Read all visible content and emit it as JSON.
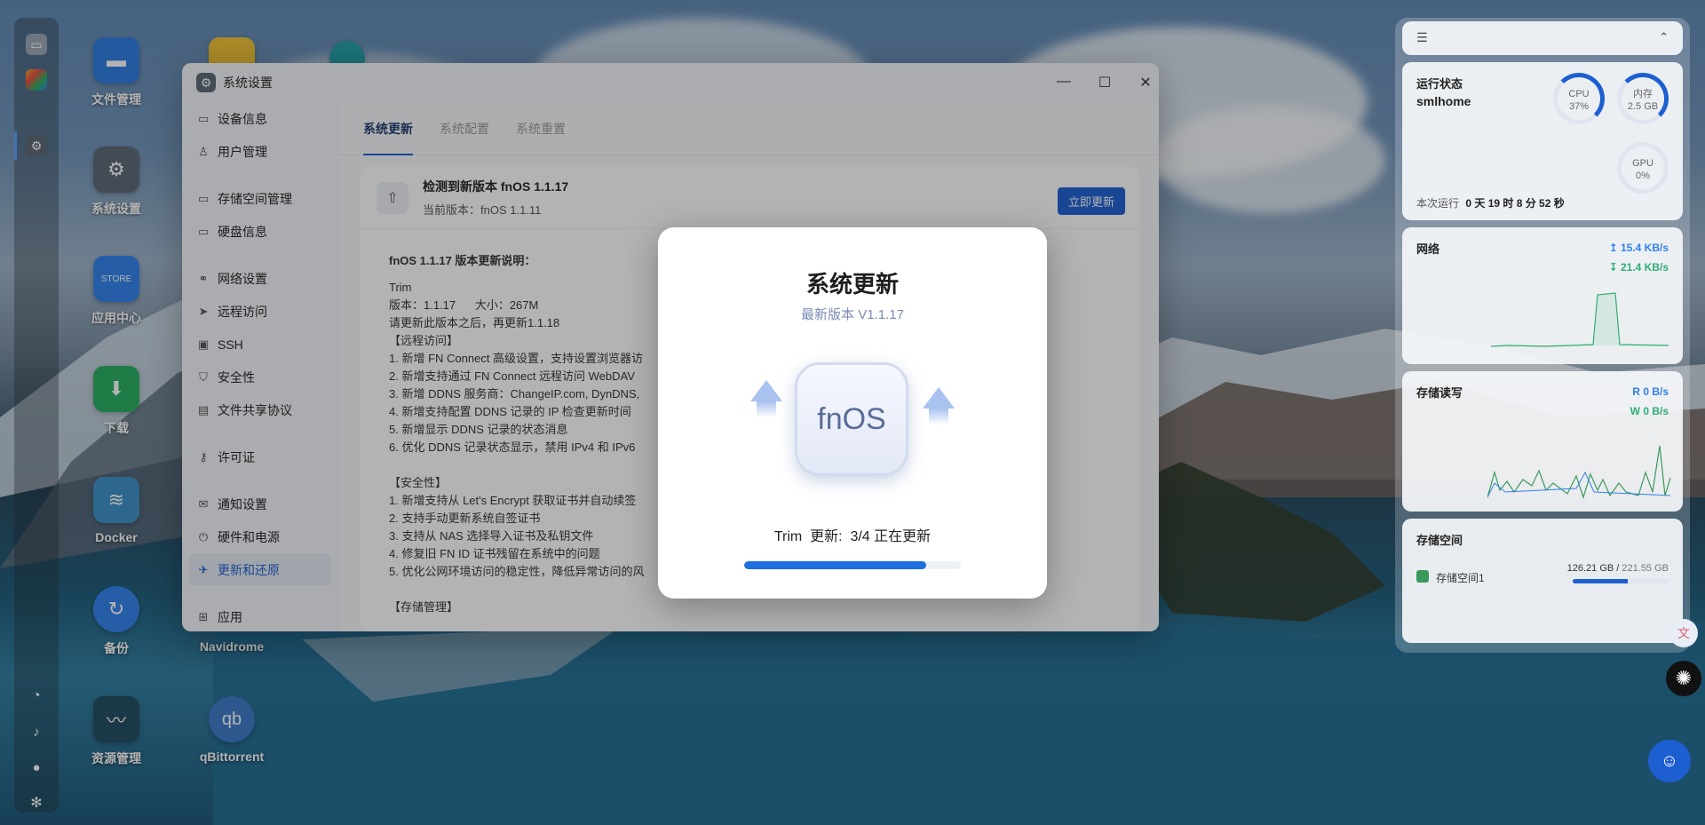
{
  "desktop": {
    "icons": [
      {
        "label": "文件管理"
      },
      {
        "label": "系统设置"
      },
      {
        "label": "应用中心"
      },
      {
        "label": "下载"
      },
      {
        "label": "Docker"
      },
      {
        "label": "备份"
      },
      {
        "label": "Navidrome"
      },
      {
        "label": "资源管理"
      },
      {
        "label": "qBittorrent"
      }
    ]
  },
  "window": {
    "title": "系统设置",
    "sidebar": [
      {
        "label": "设备信息",
        "icon": "device-icon"
      },
      {
        "label": "用户管理",
        "icon": "user-icon"
      },
      {
        "label": "存储空间管理",
        "icon": "storage-icon"
      },
      {
        "label": "硬盘信息",
        "icon": "disk-icon"
      },
      {
        "label": "网络设置",
        "icon": "network-icon"
      },
      {
        "label": "远程访问",
        "icon": "send-icon"
      },
      {
        "label": "SSH",
        "icon": "ssh-icon"
      },
      {
        "label": "安全性",
        "icon": "shield-icon"
      },
      {
        "label": "文件共享协议",
        "icon": "file-icon"
      },
      {
        "label": "许可证",
        "icon": "key-icon"
      },
      {
        "label": "通知设置",
        "icon": "mail-icon"
      },
      {
        "label": "硬件和电源",
        "icon": "power-icon"
      },
      {
        "label": "更新和还原",
        "icon": "rocket-icon"
      },
      {
        "label": "应用",
        "icon": "apps-icon"
      }
    ],
    "tabs": [
      "系统更新",
      "系统配置",
      "系统重置"
    ],
    "update": {
      "title": "检测到新版本 fnOS 1.1.17",
      "current": "当前版本：fnOS 1.1.11",
      "button": "立即更新"
    },
    "notes": {
      "heading": "fnOS 1.1.17 版本更新说明：",
      "lines": [
        "Trim",
        "版本：1.1.17      大小：267M",
        "请更新此版本之后，再更新1.1.18",
        "【远程访问】",
        "1. 新增 FN Connect 高级设置，支持设置浏览器访",
        "2. 新增支持通过 FN Connect 远程访问 WebDAV",
        "3. 新增 DDNS 服务商：ChangeIP.com, DynDNS,",
        "4. 新增支持配置 DDNS 记录的 IP 检查更新时间",
        "5. 新增显示 DDNS 记录的状态消息",
        "6. 优化 DDNS 记录状态显示，禁用 IPv4 和 IPv6",
        "",
        "【安全性】",
        "1. 新增支持从 Let's Encrypt 获取证书并自动续签",
        "2. 支持手动更新系统自签证书",
        "3. 支持从 NAS 选择导入证书及私钥文件",
        "4. 修复旧 FN ID 证书残留在系统中的问题",
        "5. 优化公网环境访问的稳定性，降低异常访问的风",
        "",
        "【存储管理】"
      ]
    }
  },
  "modal": {
    "title": "系统更新",
    "subtitle": "最新版本 V1.1.17",
    "logo_text": "fnOS",
    "status": "Trim  更新:  3/4 正在更新",
    "progress": 0.84
  },
  "widgets": {
    "run": {
      "title": "运行状态",
      "host": "smlhome",
      "cpu_label": "CPU",
      "cpu_value": "37%",
      "mem_label": "内存",
      "mem_value": "2.5 GB",
      "gpu_label": "GPU",
      "gpu_value": "0%",
      "uptime_label": "本次运行",
      "uptime_value": "0 天 19 时 8 分 52 秒"
    },
    "network": {
      "title": "网络",
      "up": "15.4 KB/s",
      "down": "21.4 KB/s"
    },
    "storage_io": {
      "title": "存储读写",
      "read": "0 B/s",
      "write": "0 B/s",
      "read_label": "R",
      "write_label": "W"
    },
    "storage": {
      "title": "存储空间",
      "volume": "存储空间1",
      "used": "126.21 GB",
      "total": "221.55 GB",
      "fraction": 0.57
    }
  },
  "colors": {
    "accent": "#1d5fd1",
    "progress": "#1d6fe0",
    "net_line": "#2fae72",
    "storage_line": "#3a9a5a"
  }
}
